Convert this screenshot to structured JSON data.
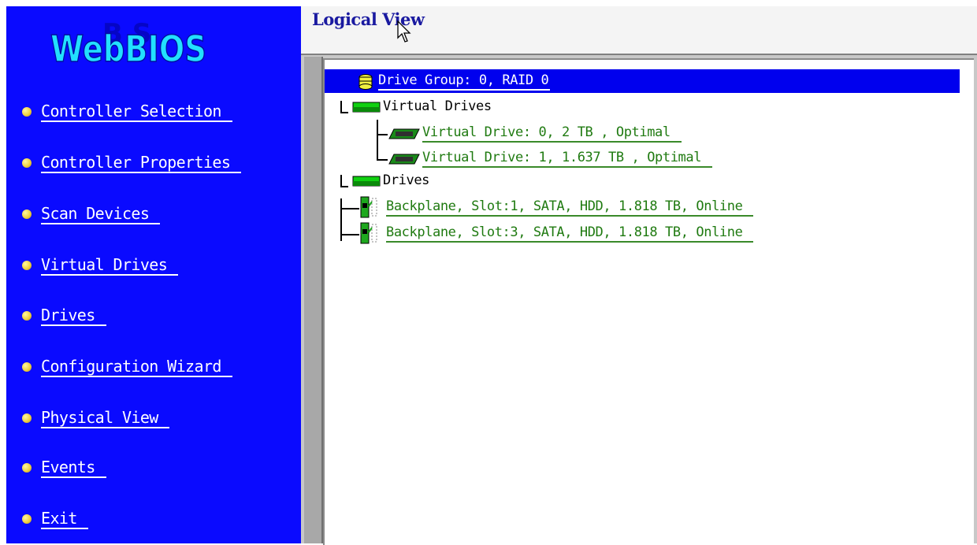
{
  "app": {
    "logo_text": "WebBIOS"
  },
  "sidebar": {
    "items": [
      {
        "label": "Controller Selection"
      },
      {
        "label": "Controller Properties"
      },
      {
        "label": "Scan Devices"
      },
      {
        "label": "Virtual Drives"
      },
      {
        "label": "Drives"
      },
      {
        "label": "Configuration Wizard"
      },
      {
        "label": "Physical View"
      },
      {
        "label": "Events"
      },
      {
        "label": "Exit"
      }
    ]
  },
  "view": {
    "title": "Logical View"
  },
  "tree": {
    "drive_group": "Drive Group: 0, RAID 0",
    "virtual_drives_label": "Virtual Drives",
    "virtual_drives": [
      "Virtual Drive: 0, 2 TB , Optimal",
      "Virtual Drive: 1, 1.637 TB , Optimal"
    ],
    "drives_label": "Drives",
    "drives": [
      "Backplane, Slot:1, SATA, HDD, 1.818 TB, Online",
      "Backplane, Slot:3, SATA, HDD, 1.818 TB, Online"
    ]
  },
  "colors": {
    "sidebar_bg": "#0a0aff",
    "selection_bg": "#0000ee",
    "link_green": "#1f7a10",
    "title_blue": "#1a1aa0"
  }
}
